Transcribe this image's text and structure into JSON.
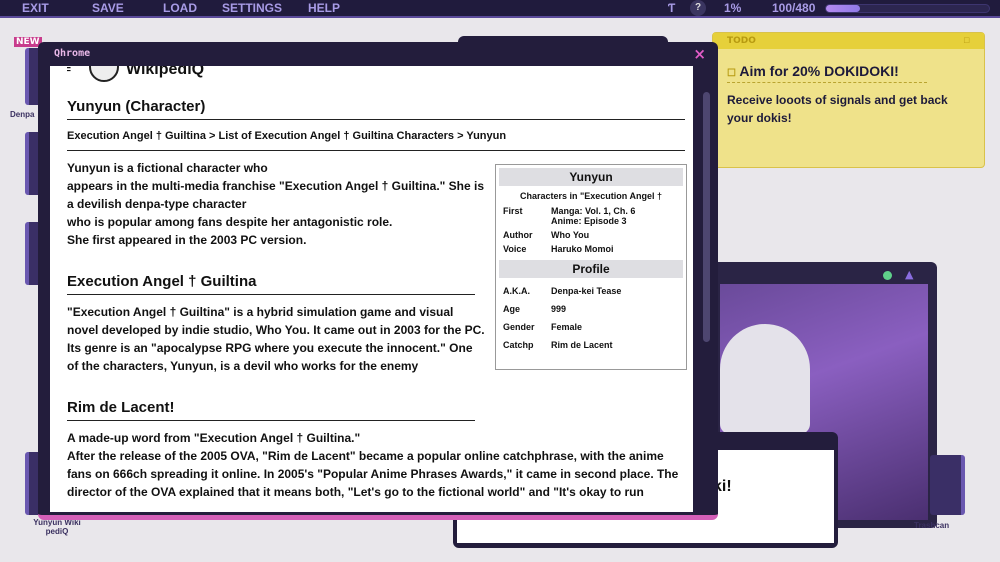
{
  "menu": {
    "exit": "EXIT",
    "save": "SAVE",
    "load": "LOAD",
    "settings": "SETTINGS",
    "help": "HELP",
    "help_icon": "?",
    "percent": "1%",
    "followers": "100/480",
    "progress": 0.21
  },
  "desktop": {
    "new_badge": "NEW",
    "denpa_label": "Denpa",
    "wiki_label": "Yunyun Wiki pediQ",
    "trash_label": "Trashcan",
    "chat_text": "ki!"
  },
  "todo": {
    "header": "TODO",
    "item": "Aim for 20% DOKIDOKI!",
    "desc": "Receive looots of signals and get back your dokis!"
  },
  "browser": {
    "title": "Qhrome",
    "close": "×",
    "logo_text": "WikipediQ",
    "menu_icon": "≡",
    "page_title": "Yunyun (Character)",
    "breadcrumb": "Execution Angel † Guiltina > List of Execution Angel † Guiltina Characters > Yunyun",
    "intro": "Yunyun is a fictional character who\n appears in the multi-media franchise \"Execution Angel † Guiltina.\" She is a devilish denpa-type character\n who is popular among fans despite her antagonistic role.\n She first appeared in the 2003 PC version.",
    "s1_title": "Execution Angel † Guiltina",
    "s1_text": "\"Execution Angel † Guiltina\" is a hybrid simulation game and visual novel developed by indie studio, Who You. It came out in 2003 for the PC. Its genre is an \"apocalypse RPG where you execute the innocent.\" One of the characters, Yunyun, is a devil who works for the enemy",
    "s2_title": "Rim de Lacent!",
    "s2_text": "A made-up word from \"Execution Angel † Guiltina.\"\n After the release of the 2005 OVA, \"Rim de Lacent\" became a popular online catchphrase, with the anime fans on 666ch spreading it online. In 2005's \"Popular Anime Phrases Awards,\" it came in second place. The director of the OVA explained that it means both, \"Let's go to the fictional world\" and \"It's okay to run",
    "infobox": {
      "name": "Yunyun",
      "sub": "Characters in \"Execution Angel †",
      "rows1": [
        {
          "k": "First",
          "v": "Manga: Vol. 1, Ch. 6\n Anime: Episode 3"
        },
        {
          "k": "Author",
          "v": "Who You"
        },
        {
          "k": "Voice",
          "v": "Haruko Momoi"
        }
      ],
      "profile": "Profile",
      "rows2": [
        {
          "k": "A.K.A.",
          "v": "Denpa-kei Tease"
        },
        {
          "k": "Age",
          "v": "999"
        },
        {
          "k": "Gender",
          "v": "Female"
        },
        {
          "k": "Catchp",
          "v": "Rim de Lacent"
        }
      ]
    }
  }
}
